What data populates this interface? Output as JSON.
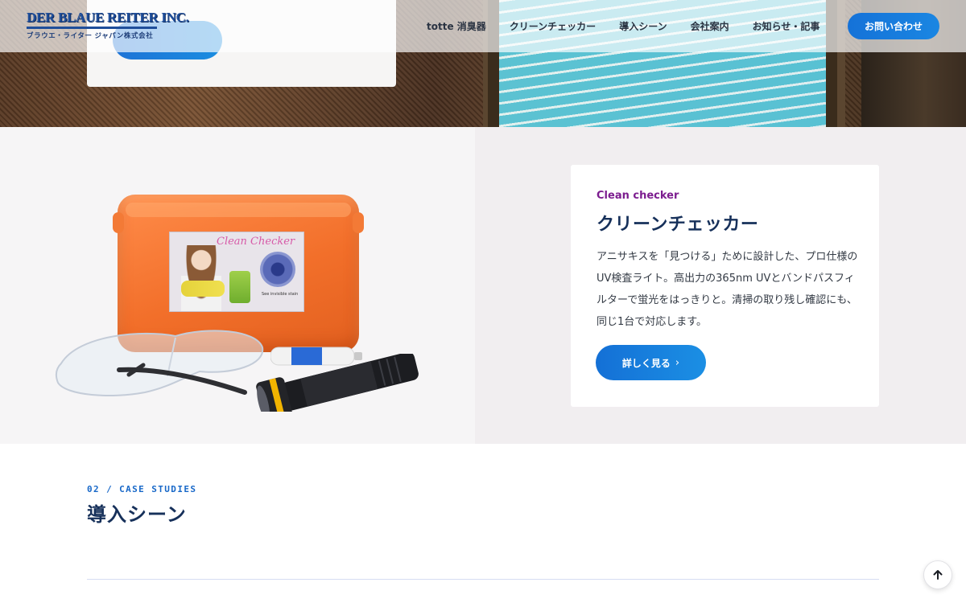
{
  "header": {
    "logo": {
      "main_text": "DER BLAUE REITER INC.",
      "sub_text": "ブラウエ・ライター ジャパン株式会社"
    },
    "nav": [
      {
        "label": "totte 消臭器"
      },
      {
        "label": "クリーンチェッカー"
      },
      {
        "label": "導入シーン"
      },
      {
        "label": "会社案内"
      },
      {
        "label": "お知らせ・記事"
      }
    ],
    "cta_label": "お問い合わせ"
  },
  "product": {
    "tag": "Clean checker",
    "title": "クリーンチェッカー",
    "description": "アニサキスを「見つける」ために設計した、プロ仕様のUV検査ライト。高出力の365nm UVとバンドパスフィルターで蛍光をはっきりと。清掃の取り残し確認にも、同じ1台で対応します。",
    "button_label": "詳しく見る",
    "button_icon": "chevron-right-icon",
    "photo": {
      "case_label_title": "Clean Checker",
      "case_label_caption": "See invisible stain"
    }
  },
  "case_studies": {
    "kicker": "02 / CASE STUDIES",
    "title": "導入シーン"
  },
  "scroll_top_icon": "arrow-up-icon",
  "colors": {
    "accent_blue": "#1572d8",
    "navy": "#16305a",
    "tag_purple": "#7c1d8f",
    "section_bg": "#f1eef0"
  }
}
